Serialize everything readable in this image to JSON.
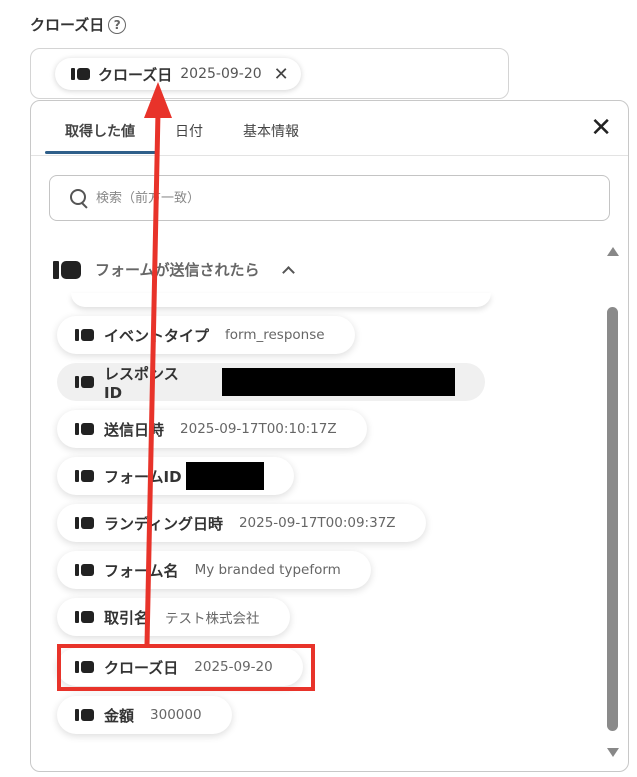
{
  "field": {
    "label": "クローズ日",
    "help_glyph": "?",
    "selected_chip": {
      "name": "クローズ日",
      "value": "2025-09-20",
      "remove_glyph": "✕"
    }
  },
  "panel": {
    "tabs": [
      {
        "label": "取得した値",
        "active": true
      },
      {
        "label": "日付",
        "active": false
      },
      {
        "label": "基本情報",
        "active": false
      }
    ],
    "close_glyph": "✕",
    "search": {
      "placeholder": "検索（前方一致）",
      "value": ""
    },
    "group": {
      "title": "フォームが送信されたら",
      "expanded": true
    },
    "items": [
      {
        "name": "イベントタイプ",
        "value": "form_response"
      },
      {
        "name": "レスポンスID",
        "value": ""
      },
      {
        "name": "送信日時",
        "value": "2025-09-17T00:10:17Z"
      },
      {
        "name": "フォームID",
        "value": ""
      },
      {
        "name": "ランディング日時",
        "value": "2025-09-17T00:09:37Z"
      },
      {
        "name": "フォーム名",
        "value": "My branded typeform"
      },
      {
        "name": "取引名",
        "value": "テスト株式会社"
      },
      {
        "name": "クローズ日",
        "value": "2025-09-20"
      },
      {
        "name": "金額",
        "value": "300000"
      }
    ]
  },
  "colors": {
    "accent_tab": "#2f5f8a",
    "annotation_red": "#e8332a"
  }
}
